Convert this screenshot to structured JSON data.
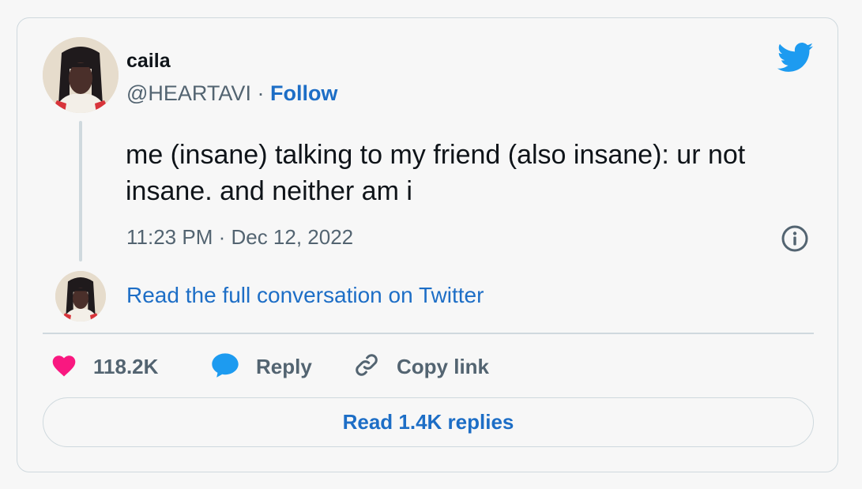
{
  "user": {
    "name": "caila",
    "handle": "@HEARTAVI",
    "separator": " · ",
    "follow_label": "Follow"
  },
  "tweet": {
    "text": "me (insane) talking to my friend (also insane): ur not insane. and neither am i",
    "timestamp": "11:23 PM · Dec 12, 2022"
  },
  "conversation_link": "Read the full conversation on Twitter",
  "actions": {
    "likes": "118.2K",
    "reply": "Reply",
    "copy_link": "Copy link"
  },
  "replies_button": "Read 1.4K replies",
  "colors": {
    "accent": "#1d6ec6",
    "like": "#f91880",
    "twitter_blue": "#1d9bf0",
    "muted_text": "#536471",
    "border": "#cfd9de"
  },
  "icons": [
    "twitter-bird-icon",
    "info-icon",
    "heart-icon",
    "reply-bubble-icon",
    "link-icon"
  ]
}
